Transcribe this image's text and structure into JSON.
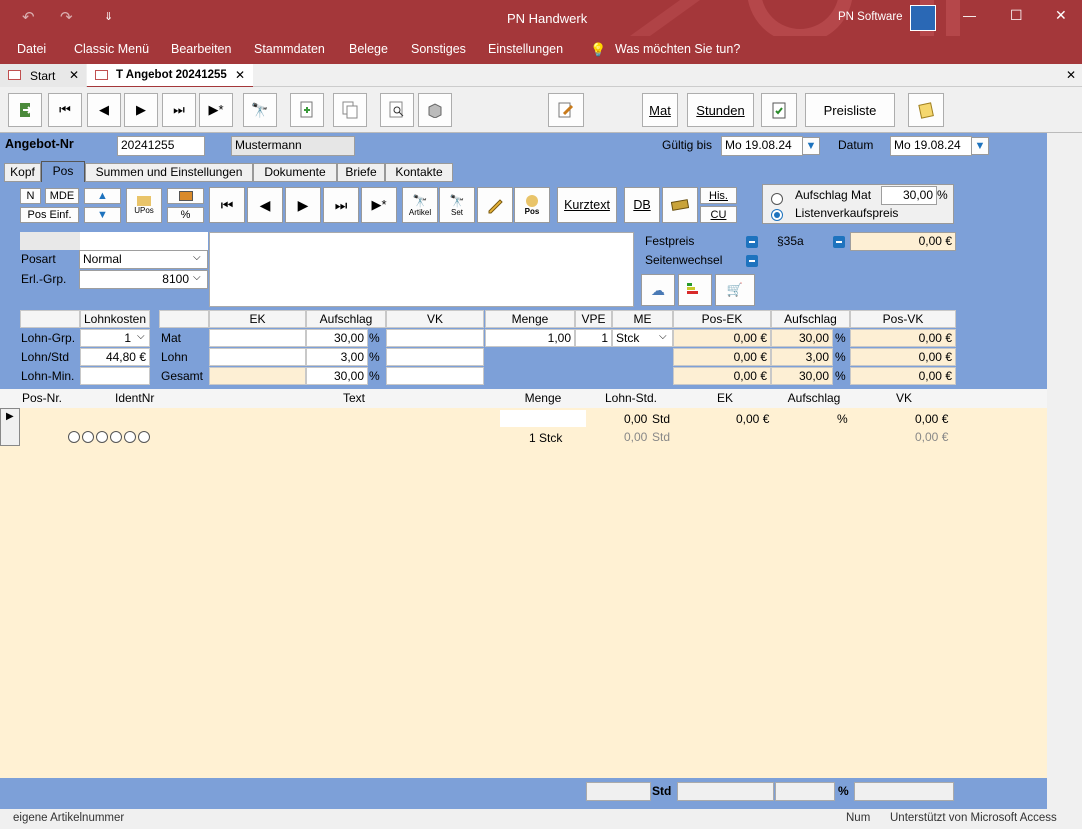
{
  "window": {
    "title": "PN Handwerk",
    "brand": "PN Software",
    "qat": [
      "↶",
      "↷",
      "⇓"
    ],
    "controls": [
      "—",
      "☐",
      "✕"
    ]
  },
  "menu": [
    "Datei",
    "Classic Menü",
    "Bearbeiten",
    "Stammdaten",
    "Belege",
    "Sonstiges",
    "Einstellungen",
    "Was möchten Sie tun?"
  ],
  "doc_tabs": [
    {
      "label": "Start",
      "active": false
    },
    {
      "label": "T Angebot 20241255",
      "active": true
    }
  ],
  "toolbar": {
    "mat": "Mat",
    "stunden": "Stunden",
    "preisliste": "Preisliste"
  },
  "header": {
    "angebot_label": "Angebot-Nr",
    "angebot_nr": "20241255",
    "kunde": "Mustermann",
    "gueltig_label": "Gültig bis",
    "gueltig": "Mo 19.08.24",
    "datum_label": "Datum",
    "datum": "Mo 19.08.24"
  },
  "form_tabs": [
    "Kopf",
    "Pos",
    "Summen und Einstellungen",
    "Dokumente",
    "Briefe",
    "Kontakte"
  ],
  "pos_toolbar": {
    "n": "N",
    "mde": "MDE",
    "pos_einf": "Pos Einf.",
    "upos": "UPos",
    "pct": "%",
    "artikel": "Artikel",
    "set": "Set",
    "pos": "Pos",
    "kurztext": "Kurztext",
    "db": "DB",
    "his": "His.",
    "cu": "CU"
  },
  "aufschlag": {
    "mat_label": "Aufschlag Mat",
    "mat_value": "30,00",
    "pct": "%",
    "liste_label": "Listenverkaufspreis"
  },
  "pos_fields": {
    "posart_label": "Posart",
    "posart": "Normal",
    "erl_label": "Erl.-Grp.",
    "erl": "8100"
  },
  "flags": {
    "festpreis": "Festpreis",
    "seitenwechsel": "Seitenwechsel",
    "para35a": "§35a",
    "para35a_value": "0,00 €"
  },
  "calc": {
    "headers": {
      "lohnkosten": "Lohnkosten",
      "ek": "EK",
      "aufschlag": "Aufschlag",
      "vk": "VK",
      "menge": "Menge",
      "vpe": "VPE",
      "me": "ME",
      "pos_ek": "Pos-EK",
      "aufschlag2": "Aufschlag",
      "pos_vk": "Pos-VK"
    },
    "lohn_grp_label": "Lohn-Grp.",
    "lohn_grp": "1",
    "lohn_std_label": "Lohn/Std",
    "lohn_std": "44,80 €",
    "lohn_min_label": "Lohn-Min.",
    "rows": [
      {
        "label": "Mat",
        "aufschlag": "30,00",
        "pct": "%",
        "menge": "1,00",
        "vpe": "1",
        "me": "Stck",
        "pos_ek": "0,00 €",
        "aufschlag2": "30,00",
        "pct2": "%",
        "pos_vk": "0,00 €"
      },
      {
        "label": "Lohn",
        "aufschlag": "3,00",
        "pct": "%",
        "pos_ek": "0,00 €",
        "aufschlag2": "3,00",
        "pct2": "%",
        "pos_vk": "0,00 €"
      },
      {
        "label": "Gesamt",
        "aufschlag": "30,00",
        "pct": "%",
        "pos_ek": "0,00 €",
        "aufschlag2": "30,00",
        "pct2": "%",
        "pos_vk": "0,00 €"
      }
    ]
  },
  "grid": {
    "columns": [
      "Pos-Nr.",
      "IdentNr",
      "Text",
      "Menge",
      "Lohn-Std.",
      "EK",
      "Aufschlag",
      "VK"
    ],
    "row1": {
      "lohn_std": "0,00",
      "std": "Std",
      "ek": "0,00 €",
      "aufschlag": "%",
      "vk": "0,00 €"
    },
    "row2": {
      "menge": "1 Stck",
      "lohn_std": "0,00",
      "std": "Std",
      "vk": "0,00 €"
    }
  },
  "footer": {
    "std": "Std",
    "pct": "%"
  },
  "statusbar": {
    "left": "eigene Artikelnummer",
    "num": "Num",
    "right": "Unterstützt von Microsoft Access"
  },
  "colors": {
    "titlebar": "#a4373a",
    "form_bg": "#7da0d8",
    "grid_bg": "#fff1d3",
    "calc_cell": "#fdefd4",
    "accent": "#1e73be"
  }
}
